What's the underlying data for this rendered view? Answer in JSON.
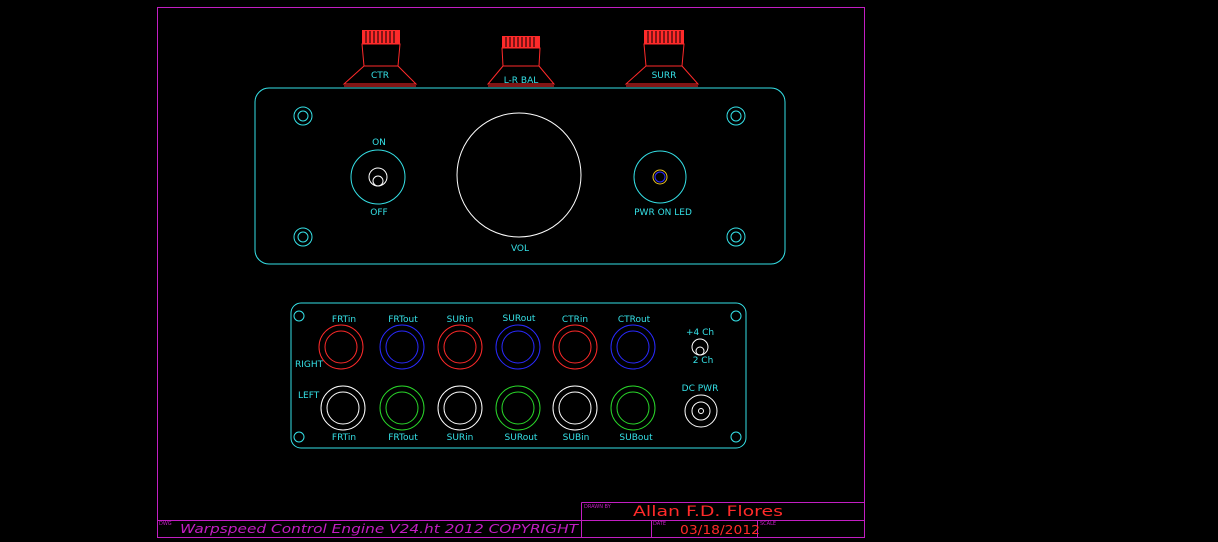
{
  "colors": {
    "border": "#c21ec2",
    "panel": "#35e0e6",
    "knob": "#ff2a2a",
    "red_jack": "#ff2a2a",
    "blue_jack": "#2a2aff",
    "white_jack": "#ffffff",
    "green_jack": "#2ad82a",
    "led": "#e8c020",
    "title": "#c21ec2"
  },
  "top_knobs": {
    "ctr": "CTR",
    "lr_bal": "L-R BAL",
    "surr": "SURR"
  },
  "front_panel": {
    "on": "ON",
    "off": "OFF",
    "vol": "VOL",
    "pwr_led": "PWR ON LED"
  },
  "rear_panel": {
    "right_label": "RIGHT",
    "left_label": "LEFT",
    "top_labels": [
      "FRTin",
      "FRTout",
      "SURin",
      "SURout",
      "CTRin",
      "CTRout"
    ],
    "bottom_labels": [
      "FRTin",
      "FRTout",
      "SURin",
      "SURout",
      "SUBin",
      "SUBout"
    ],
    "four_ch": "+4 Ch",
    "two_ch": "2 Ch",
    "dc_pwr": "DC PWR"
  },
  "title_block": {
    "dwg_tag": "DWG",
    "title": "Warpspeed Control Engine  V24.ht   2012  COPYRIGHT",
    "drawn_by_tag": "DRAWN BY",
    "author": "Allan  F.D.  Flores",
    "date_tag": "DATE",
    "date": "03/18/2012",
    "scale_tag": "SCALE"
  }
}
